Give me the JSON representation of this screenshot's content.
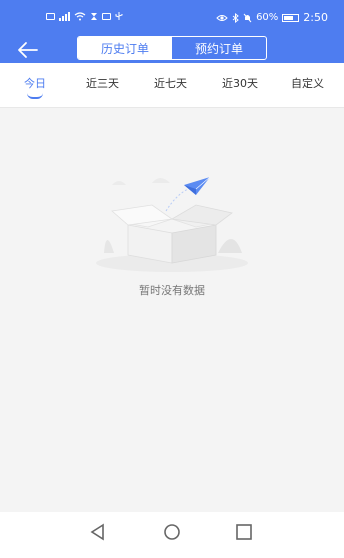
{
  "status_bar": {
    "left_icons": [
      "notification-icon",
      "signal-icon",
      "wifi-icon",
      "hourglass-icon",
      "app-icon",
      "usb-icon"
    ],
    "right_icons": [
      "eye-icon",
      "bluetooth-icon",
      "mute-icon"
    ],
    "battery": "60%",
    "time": "2:50"
  },
  "header": {
    "back_icon": "back-arrow-icon",
    "segments": [
      {
        "label": "历史订单",
        "active": true
      },
      {
        "label": "预约订单",
        "active": false
      }
    ]
  },
  "filter_tabs": [
    {
      "label": "今日",
      "active": true
    },
    {
      "label": "近三天",
      "active": false
    },
    {
      "label": "近七天",
      "active": false
    },
    {
      "label": "近30天",
      "active": false
    },
    {
      "label": "自定义",
      "active": false
    }
  ],
  "empty_state": {
    "illustration": "empty-box-with-paper-plane",
    "text": "暂时没有数据"
  },
  "bottom_nav": [
    "back-triangle-icon",
    "home-circle-icon",
    "recents-square-icon"
  ],
  "colors": {
    "primary": "#4e7df0",
    "background": "#f4f4f4",
    "tab_text": "#333333",
    "empty_text": "#777777"
  }
}
